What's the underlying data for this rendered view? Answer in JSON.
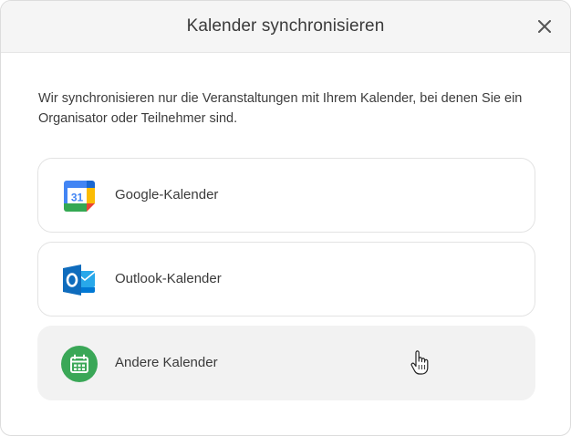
{
  "dialog": {
    "title": "Kalender synchronisieren",
    "close_icon": "close-icon",
    "intro": "Wir synchronisieren nur die Veranstaltungen mit Ihrem Kalender, bei denen Sie ein Organisator oder Teilnehmer sind."
  },
  "options": [
    {
      "label": "Google-Kalender",
      "icon": "google-calendar-icon",
      "icon_text": "31"
    },
    {
      "label": "Outlook-Kalender",
      "icon": "outlook-icon",
      "icon_text": "O"
    },
    {
      "label": "Andere Kalender",
      "icon": "calendar-icon",
      "state": "hover"
    }
  ],
  "colors": {
    "header_bg": "#f5f5f5",
    "google_blue": "#4285f4",
    "google_green": "#34a853",
    "google_yellow": "#fbbc04",
    "google_red": "#ea4335",
    "outlook_blue": "#0f6cbd",
    "other_green": "#3aa757",
    "hover_bg": "#f2f2f2"
  }
}
